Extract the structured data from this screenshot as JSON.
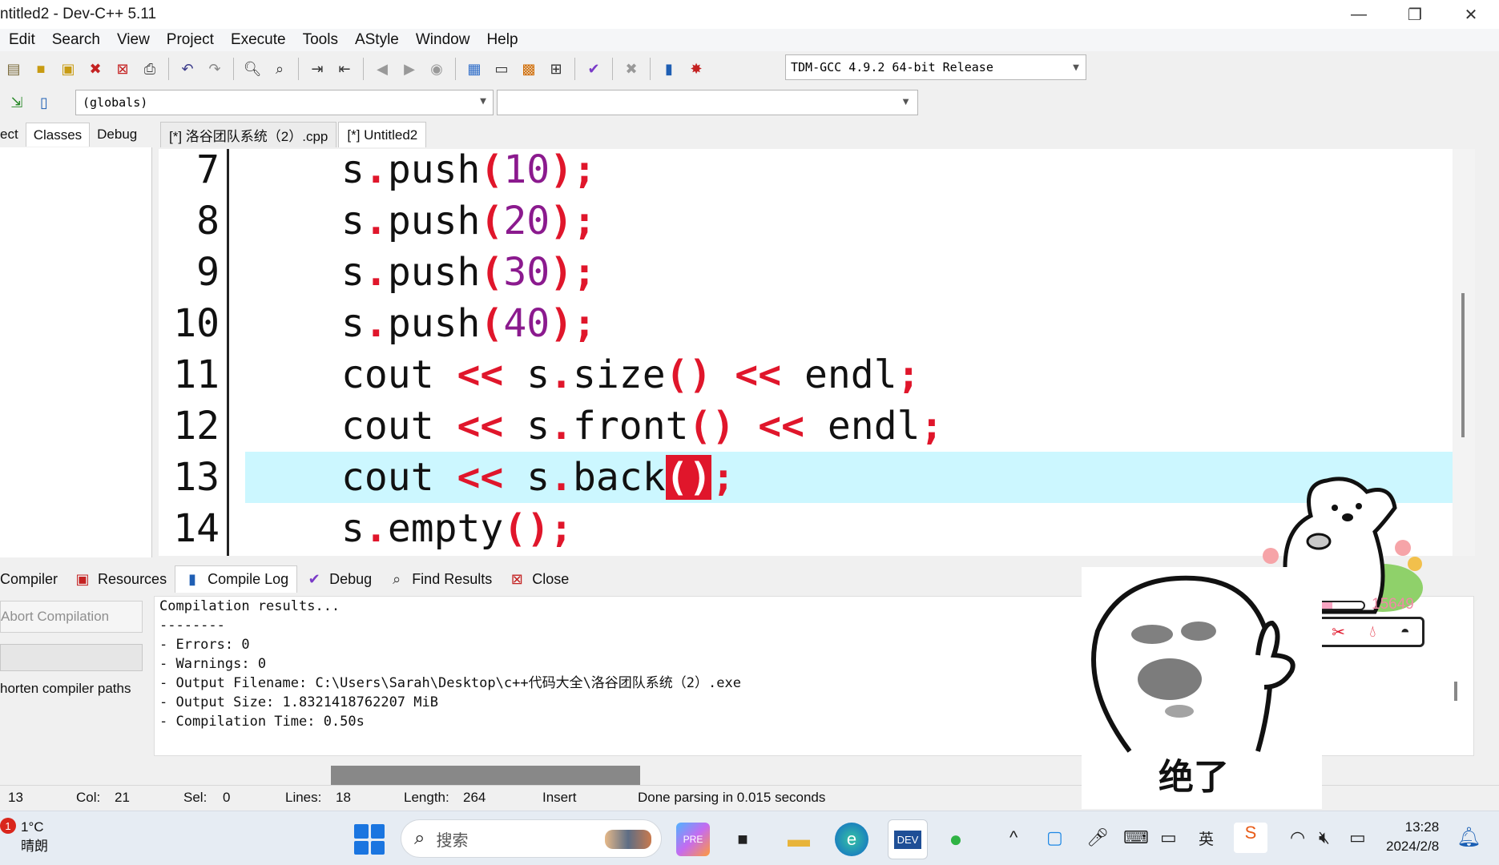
{
  "window": {
    "title": "ntitled2 - Dev-C++ 5.11"
  },
  "menu": [
    "Edit",
    "Search",
    "View",
    "Project",
    "Execute",
    "Tools",
    "AStyle",
    "Window",
    "Help"
  ],
  "toolbar": {
    "compiler": "TDM-GCC 4.9.2 64-bit Release",
    "scope": "(globals)"
  },
  "left_tabs": [
    "ect",
    "Classes",
    "Debug"
  ],
  "editor_tabs": [
    {
      "label": "[*] 洛谷团队系统（2）.cpp",
      "active": false
    },
    {
      "label": "[*] Untitled2",
      "active": true
    }
  ],
  "code": [
    {
      "no": "7",
      "current": false
    },
    {
      "no": "8",
      "current": false
    },
    {
      "no": "9",
      "current": false
    },
    {
      "no": "10",
      "current": false
    },
    {
      "no": "11",
      "current": false
    },
    {
      "no": "12",
      "current": false
    },
    {
      "no": "13",
      "current": true
    },
    {
      "no": "14",
      "current": false
    }
  ],
  "code_text": {
    "l7": [
      "s",
      ".",
      "push",
      "(",
      "10",
      ");"
    ],
    "l8": [
      "s",
      ".",
      "push",
      "(",
      "20",
      ");"
    ],
    "l9": [
      "s",
      ".",
      "push",
      "(",
      "30",
      ");"
    ],
    "l10": [
      "s",
      ".",
      "push",
      "(",
      "40",
      ");"
    ],
    "l11": [
      "cout ",
      "<<",
      " s",
      ".",
      "size",
      "()",
      " ",
      "<<",
      " endl",
      ";"
    ],
    "l12": [
      "cout ",
      "<<",
      " s",
      ".",
      "front",
      "()",
      " ",
      "<<",
      " endl",
      ";"
    ],
    "l13": [
      "cout ",
      "<<",
      " s",
      ".",
      "back",
      "()",
      ";"
    ],
    "l14": [
      "s",
      ".",
      "empty",
      "();"
    ]
  },
  "bottom_tabs": [
    "Compiler",
    "Resources",
    "Compile Log",
    "Debug",
    "Find Results",
    "Close"
  ],
  "compile": {
    "abort": "Abort Compilation",
    "shorten": "horten compiler paths",
    "log": [
      "Compilation results...",
      "--------",
      "- Errors: 0",
      "- Warnings: 0",
      "- Output Filename: C:\\Users\\Sarah\\Desktop\\c++代码大全\\洛谷团队系统（2）.exe",
      "- Output Size: 1.8321418762207 MiB",
      "- Compilation Time: 0.50s"
    ]
  },
  "status": {
    "line": "13",
    "col_label": "Col:",
    "col": "21",
    "sel_label": "Sel:",
    "sel": "0",
    "lines_label": "Lines:",
    "lines": "18",
    "length_label": "Length:",
    "length": "264",
    "mode": "Insert",
    "message": "Done parsing in 0.015 seconds"
  },
  "taskbar": {
    "weather_temp": "1°C",
    "weather_desc": "晴朗",
    "weather_badge": "1",
    "search_placeholder": "搜索",
    "time": "13:28",
    "date": "2024/2/8"
  },
  "stickers": {
    "face_caption": "绝了",
    "koala_score": "15649"
  },
  "colors": {
    "keyword_red": "#e0162b",
    "number_purple": "#8b1a8e",
    "current_line": "#ccf7ff"
  }
}
